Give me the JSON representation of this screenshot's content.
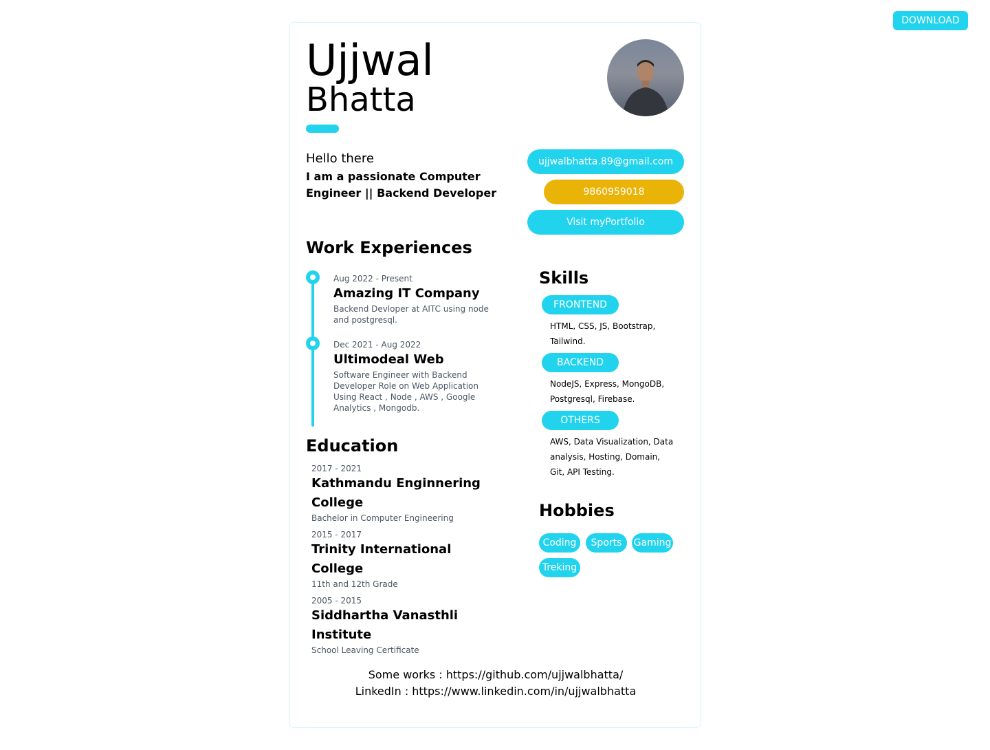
{
  "toolbar": {
    "download_label": "DOWNLOAD"
  },
  "profile": {
    "first_name": "Ujjwal",
    "last_name": "Bhatta",
    "greeting": "Hello there",
    "intro": "I am a passionate Computer Engineer || Backend Developer"
  },
  "contact": {
    "email": "ujjwalbhatta.89@gmail.com",
    "phone": "9860959018",
    "portfolio_label": "Visit myPortfolio"
  },
  "work": {
    "title": "Work Experiences",
    "items": [
      {
        "dates": "Aug 2022 - Present",
        "company": "Amazing IT Company",
        "description": "Backend Devloper at AITC using node and postgresql."
      },
      {
        "dates": "Dec 2021 - Aug 2022",
        "company": "Ultimodeal Web",
        "description": "Software Engineer with Backend Developer Role on Web Application Using React , Node , AWS , Google Analytics , Mongodb."
      }
    ]
  },
  "education": {
    "title": "Education",
    "items": [
      {
        "years": "2017 - 2021",
        "school": "Kathmandu Enginnering College",
        "degree": "Bachelor in Computer Engineering"
      },
      {
        "years": "2015 - 2017",
        "school": "Trinity International College",
        "degree": "11th and 12th Grade"
      },
      {
        "years": "2005 - 2015",
        "school": "Siddhartha Vanasthli Institute",
        "degree": "School Leaving Certificate"
      }
    ]
  },
  "skills": {
    "title": "Skills",
    "groups": [
      {
        "label": "FRONTEND",
        "items": "HTML, CSS, JS, Bootstrap, Tailwind."
      },
      {
        "label": "BACKEND",
        "items": "NodeJS, Express, MongoDB, Postgresql, Firebase."
      },
      {
        "label": "OTHERS",
        "items": "AWS, Data Visualization, Data analysis, Hosting, Domain, Git, API Testing."
      }
    ]
  },
  "hobbies": {
    "title": "Hobbies",
    "items": [
      "Coding",
      "Sports",
      "Gaming",
      "Treking"
    ]
  },
  "footer": {
    "works_label": "Some works :",
    "works_url": "https://github.com/ujjwalbhatta/",
    "linkedin_label": "LinkedIn :",
    "linkedin_url": "https://www.linkedin.com/in/ujjwalbhatta"
  },
  "colors": {
    "accent": "#22d3ee",
    "phone": "#eab308",
    "muted_text": "#4b5563",
    "card_border": "#cff4fa"
  },
  "icons": [
    "profile-photo"
  ]
}
